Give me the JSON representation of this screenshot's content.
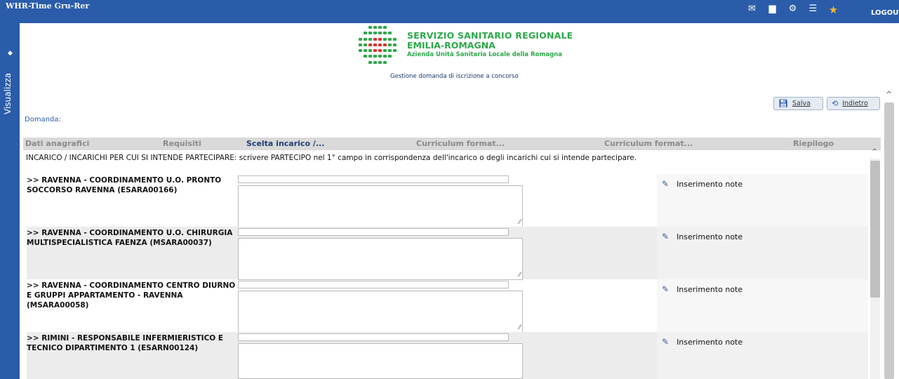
{
  "app": {
    "title": "WHR-Time Gru-Rer",
    "logout_label": "LOGOUT"
  },
  "top_icons": [
    "mail-icon",
    "document-icon",
    "settings-icon",
    "list-icon",
    "star-icon"
  ],
  "side": {
    "label": "Visualizza"
  },
  "brand": {
    "line1": "SERVIZIO SANITARIO REGIONALE",
    "line2": "EMILIA-ROMAGNA",
    "line3": "Azienda Unità Sanitaria Locale della Romagna",
    "subtitle": "Gestione domanda di iscrizione a concorso",
    "colors": {
      "green": "#2ca84a",
      "red": "#d9322e"
    }
  },
  "toolbar": {
    "save_label": "Salva",
    "back_label": "Indietro"
  },
  "domanda_label": "Domanda:",
  "tabs": [
    {
      "label": "Dati anagrafici"
    },
    {
      "label": "Requisiti"
    },
    {
      "label": "Scelta incarico /..."
    },
    {
      "label": "Curriculum format..."
    },
    {
      "label": "Curriculum format..."
    },
    {
      "label": "Riepilogo"
    }
  ],
  "intro": "INCARICO / INCARICHI PER CUI SI INTENDE PARTECIPARE: scrivere PARTECIPO nel 1° campo in corrispondenza dell'incarico o degli incarichi cui si intende partecipare.",
  "note_label": "Inserimento note",
  "rows": [
    {
      "label": ">> RAVENNA - COORDINAMENTO U.O. PRONTO SOCCORSO RAVENNA (ESARA00166)",
      "value": ""
    },
    {
      "label": ">> RAVENNA - COORDINAMENTO U.O. CHIRURGIA MULTISPECIALISTICA FAENZA (MSARA00037)",
      "value": ""
    },
    {
      "label": ">> RAVENNA - COORDINAMENTO CENTRO DIURNO E GRUPPI APPARTAMENTO - RAVENNA (MSARA00058)",
      "value": ""
    },
    {
      "label": ">> RIMINI - RESPONSABILE INFERMIERISTICO E TECNICO DIPARTIMENTO 1 (ESARN00124)",
      "value": ""
    }
  ],
  "colors": {
    "header_blue": "#2a5caa",
    "tab_active": "#1f3d73"
  }
}
